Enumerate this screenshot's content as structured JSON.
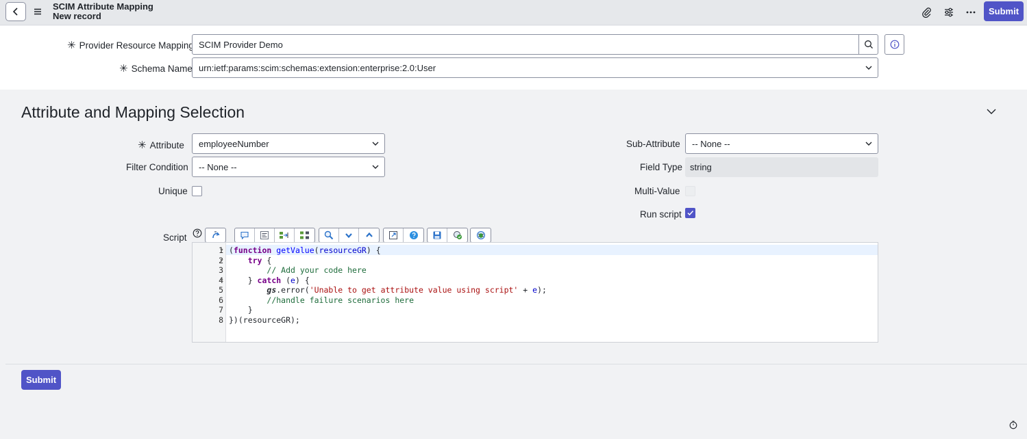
{
  "header": {
    "title": "SCIM Attribute Mapping",
    "subtitle": "New record",
    "submit_label": "Submit",
    "icons": [
      "back-icon",
      "menu-icon",
      "attachment-icon",
      "settings-sliders-icon",
      "more-icon"
    ]
  },
  "top_form": {
    "provider_label": "Provider Resource Mapping",
    "provider_value": "SCIM Provider Demo",
    "schema_label": "Schema Name",
    "schema_value": "urn:ietf:params:scim:schemas:extension:enterprise:2.0:User"
  },
  "section": {
    "title": "Attribute and Mapping Selection",
    "attribute_label": "Attribute",
    "attribute_value": "employeeNumber",
    "filter_label": "Filter Condition",
    "filter_value": "-- None --",
    "unique_label": "Unique",
    "unique_checked": false,
    "sub_attribute_label": "Sub-Attribute",
    "sub_attribute_value": "-- None --",
    "field_type_label": "Field Type",
    "field_type_value": "string",
    "multi_value_label": "Multi-Value",
    "run_script_label": "Run script",
    "run_script_checked": true,
    "script_label": "Script"
  },
  "script": {
    "line_numbers": [
      "1",
      "2",
      "3",
      "4",
      "5",
      "6",
      "7",
      "8"
    ],
    "lines": [
      "(function getValue(resourceGR) {",
      "    try {",
      "        // Add your code here",
      "    } catch (e) {",
      "        gs.error('Unable to get attribute value using script' + e);",
      "        //handle failure scenarios here",
      "    }",
      "})(resourceGR);"
    ]
  },
  "footer": {
    "submit_label": "Submit"
  },
  "colors": {
    "accent": "#5054c7",
    "header_bg": "#e6e8eb",
    "section_bg": "#f1f2f4"
  }
}
